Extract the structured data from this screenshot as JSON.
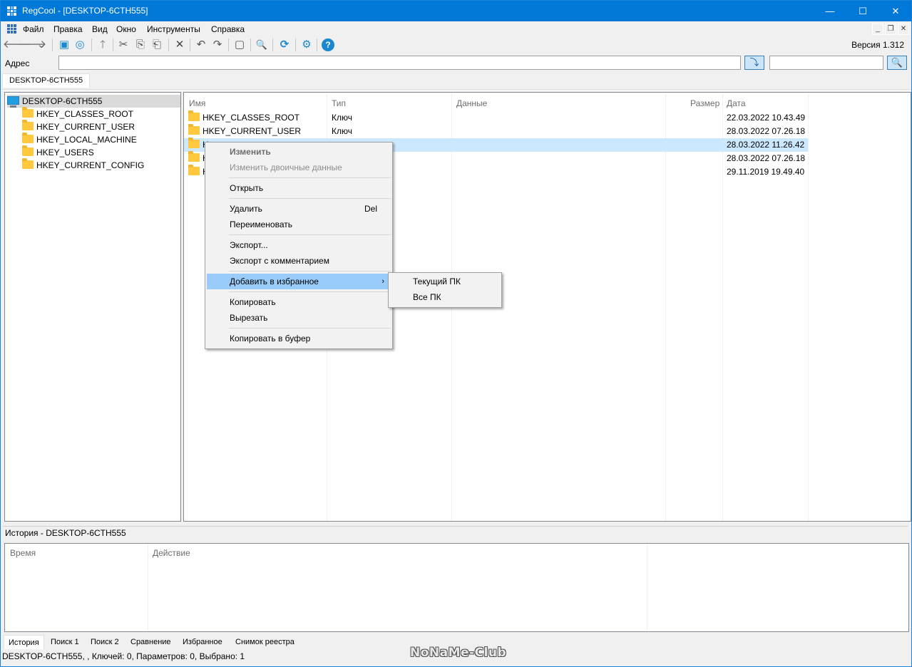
{
  "window": {
    "title": "RegCool - [DESKTOP-6CTH555]",
    "minimize": "—",
    "maximize": "☐",
    "close": "✕"
  },
  "menu": {
    "items": [
      "Файл",
      "Правка",
      "Вид",
      "Окно",
      "Инструменты",
      "Справка"
    ],
    "mdi_minimize": "_",
    "mdi_restore": "❐",
    "mdi_close": "✕"
  },
  "toolbar": {
    "version": "Версия 1.312",
    "icons": {
      "back": "🡐",
      "forward": "🡒",
      "dropdown": "⌄",
      "computer": "▣",
      "network": "◎",
      "up": "🡑",
      "cut": "✂",
      "copy": "⎘",
      "paste": "⎗",
      "delete": "✕",
      "undo": "↶",
      "redo": "↷",
      "new_key": "▢",
      "find": "🔍",
      "refresh": "⟳",
      "settings": "⚙",
      "help": "?"
    }
  },
  "address": {
    "label": "Адрес",
    "value": "",
    "go_icon": "⤵",
    "search_value": "",
    "search_icon": "🔍"
  },
  "doc_tab": "DESKTOP-6CTH555",
  "tree": {
    "root": "DESKTOP-6CTH555",
    "items": [
      "HKEY_CLASSES_ROOT",
      "HKEY_CURRENT_USER",
      "HKEY_LOCAL_MACHINE",
      "HKEY_USERS",
      "HKEY_CURRENT_CONFIG"
    ]
  },
  "list": {
    "columns": {
      "name": "Имя",
      "type": "Тип",
      "data": "Данные",
      "size": "Размер",
      "date": "Дата"
    },
    "rows": [
      {
        "name": "HKEY_CLASSES_ROOT",
        "type": "Ключ",
        "date": "22.03.2022 10.43.49"
      },
      {
        "name": "HKEY_CURRENT_USER",
        "type": "Ключ",
        "date": "28.03.2022 07.26.18"
      },
      {
        "name": "H",
        "type": "",
        "date": "28.03.2022 11.26.42"
      },
      {
        "name": "H",
        "type": "",
        "date": "28.03.2022 07.26.18"
      },
      {
        "name": "H",
        "type": "",
        "date": "29.11.2019 19.49.40"
      }
    ]
  },
  "context_menu": {
    "edit": "Изменить",
    "edit_binary": "Изменить двоичные данные",
    "open": "Открыть",
    "delete": "Удалить",
    "delete_shortcut": "Del",
    "rename": "Переименовать",
    "export": "Экспорт...",
    "export_comment": "Экспорт с комментарием",
    "add_favorites": "Добавить в избранное",
    "submenu_arrow": "›",
    "copy": "Копировать",
    "cut": "Вырезать",
    "copy_clipboard": "Копировать в буфер"
  },
  "submenu": {
    "current_pc": "Текущий ПК",
    "all_pc": "Все ПК"
  },
  "history": {
    "title": "История - DESKTOP-6CTH555",
    "col_time": "Время",
    "col_action": "Действие"
  },
  "bottom_tabs": [
    "История",
    "Поиск 1",
    "Поиск 2",
    "Сравнение",
    "Избранное",
    "Снимок реестра"
  ],
  "status": "DESKTOP-6CTH555, , Ключей: 0, Параметров: 0, Выбрано: 1",
  "watermark": "NoNaMe-Club"
}
